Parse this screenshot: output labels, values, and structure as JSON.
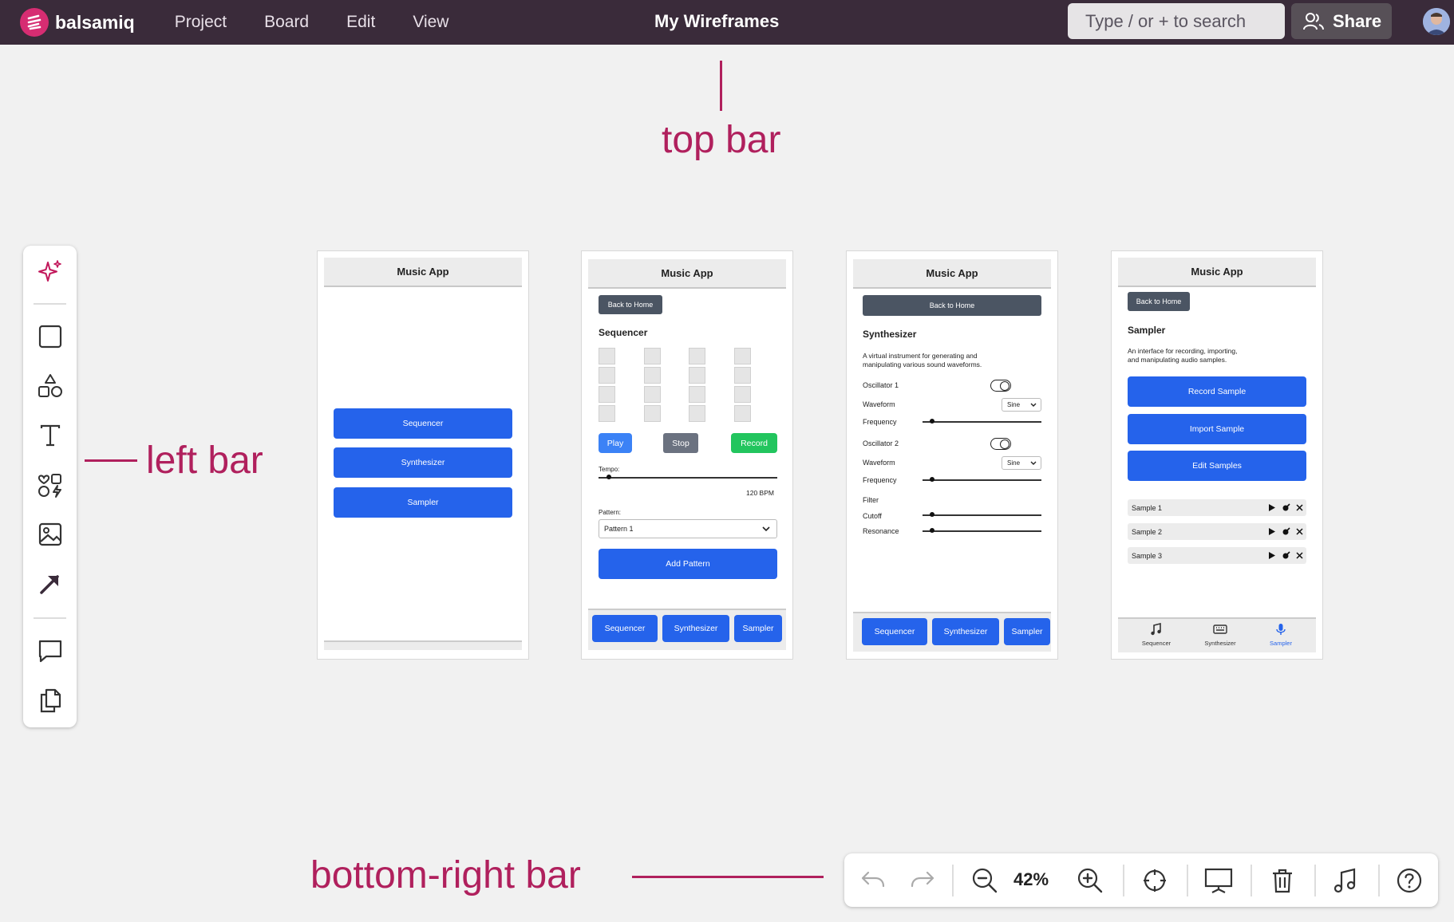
{
  "topbar": {
    "brand": "balsamiq",
    "menu": [
      "Project",
      "Board",
      "Edit",
      "View"
    ],
    "doc_title": "My Wireframes",
    "search_placeholder": "Type / or + to search",
    "share_label": "Share"
  },
  "annotations": {
    "top": "top bar",
    "left": "left bar",
    "bottom_right": "bottom-right bar"
  },
  "left_toolbar": [
    "sparkle-icon",
    "rectangle-icon",
    "shapes-icon",
    "text-icon",
    "icons-icon",
    "image-icon",
    "arrow-icon",
    "comment-icon",
    "copy-icon"
  ],
  "frames": {
    "home": {
      "title": "Music App",
      "buttons": [
        "Sequencer",
        "Synthesizer",
        "Sampler"
      ]
    },
    "sequencer": {
      "title": "Music App",
      "back": "Back to Home",
      "heading": "Sequencer",
      "play": "Play",
      "stop": "Stop",
      "record": "Record",
      "tempo_label": "Tempo:",
      "bpm": "120 BPM",
      "pattern_label": "Pattern:",
      "pattern_value": "Pattern 1",
      "add_pattern": "Add Pattern",
      "nav": [
        "Sequencer",
        "Synthesizer",
        "Sampler"
      ],
      "colors": {
        "record": "#22c55e",
        "stop": "#6b7280"
      }
    },
    "synth": {
      "title": "Music App",
      "back": "Back to Home",
      "heading": "Synthesizer",
      "desc_line1": "A virtual instrument for generating and",
      "desc_line2": "manipulating various sound waveforms.",
      "osc1": "Oscillator 1",
      "waveform1": "Waveform",
      "wave1_value": "Sine",
      "freq1": "Frequency",
      "osc2": "Oscillator 2",
      "waveform2": "Waveform",
      "wave2_value": "Sine",
      "freq2": "Frequency",
      "filter": "Filter",
      "cutoff": "Cutoff",
      "resonance": "Resonance",
      "nav": [
        "Sequencer",
        "Synthesizer",
        "Sampler"
      ]
    },
    "sampler": {
      "title": "Music App",
      "back": "Back to Home",
      "heading": "Sampler",
      "desc_line1": "An interface for recording, importing,",
      "desc_line2": "and manipulating audio samples.",
      "record": "Record Sample",
      "import": "Import Sample",
      "edit": "Edit Samples",
      "samples": [
        "Sample 1",
        "Sample 2",
        "Sample 3"
      ],
      "tabs": [
        "Sequencer",
        "Synthesizer",
        "Sampler"
      ]
    }
  },
  "bottom_bar": {
    "zoom": "42%"
  },
  "colors": {
    "brand": "#d62d72",
    "topbar": "#3a2b3a",
    "accent_blue": "#2563eb",
    "annotation": "#b0205d"
  }
}
